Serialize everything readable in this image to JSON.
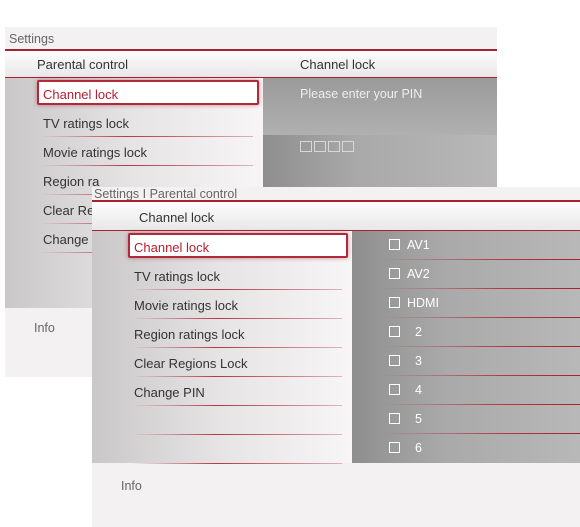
{
  "back": {
    "breadcrumb": "Settings",
    "left_header": "Parental control",
    "right_header": "Channel lock",
    "pin_prompt": "Please enter your PIN",
    "pin_digits": 4,
    "menu": [
      "Channel lock",
      "TV ratings lock",
      "Movie ratings lock",
      "Region ra",
      "Clear Reg",
      "Change I"
    ],
    "info": "Info"
  },
  "front": {
    "breadcrumb": "Settings I Parental control",
    "header": "Channel lock",
    "menu": [
      "Channel lock",
      "TV ratings lock",
      "Movie ratings lock",
      "Region ratings lock",
      "Clear Regions Lock",
      "Change PIN"
    ],
    "selected_index": 0,
    "channels": [
      "AV1",
      "AV2",
      "HDMI",
      "2",
      "3",
      "4",
      "5",
      "6"
    ],
    "info": "Info"
  },
  "colors": {
    "accent": "#a8212f",
    "selected_text": "#b5202f"
  }
}
